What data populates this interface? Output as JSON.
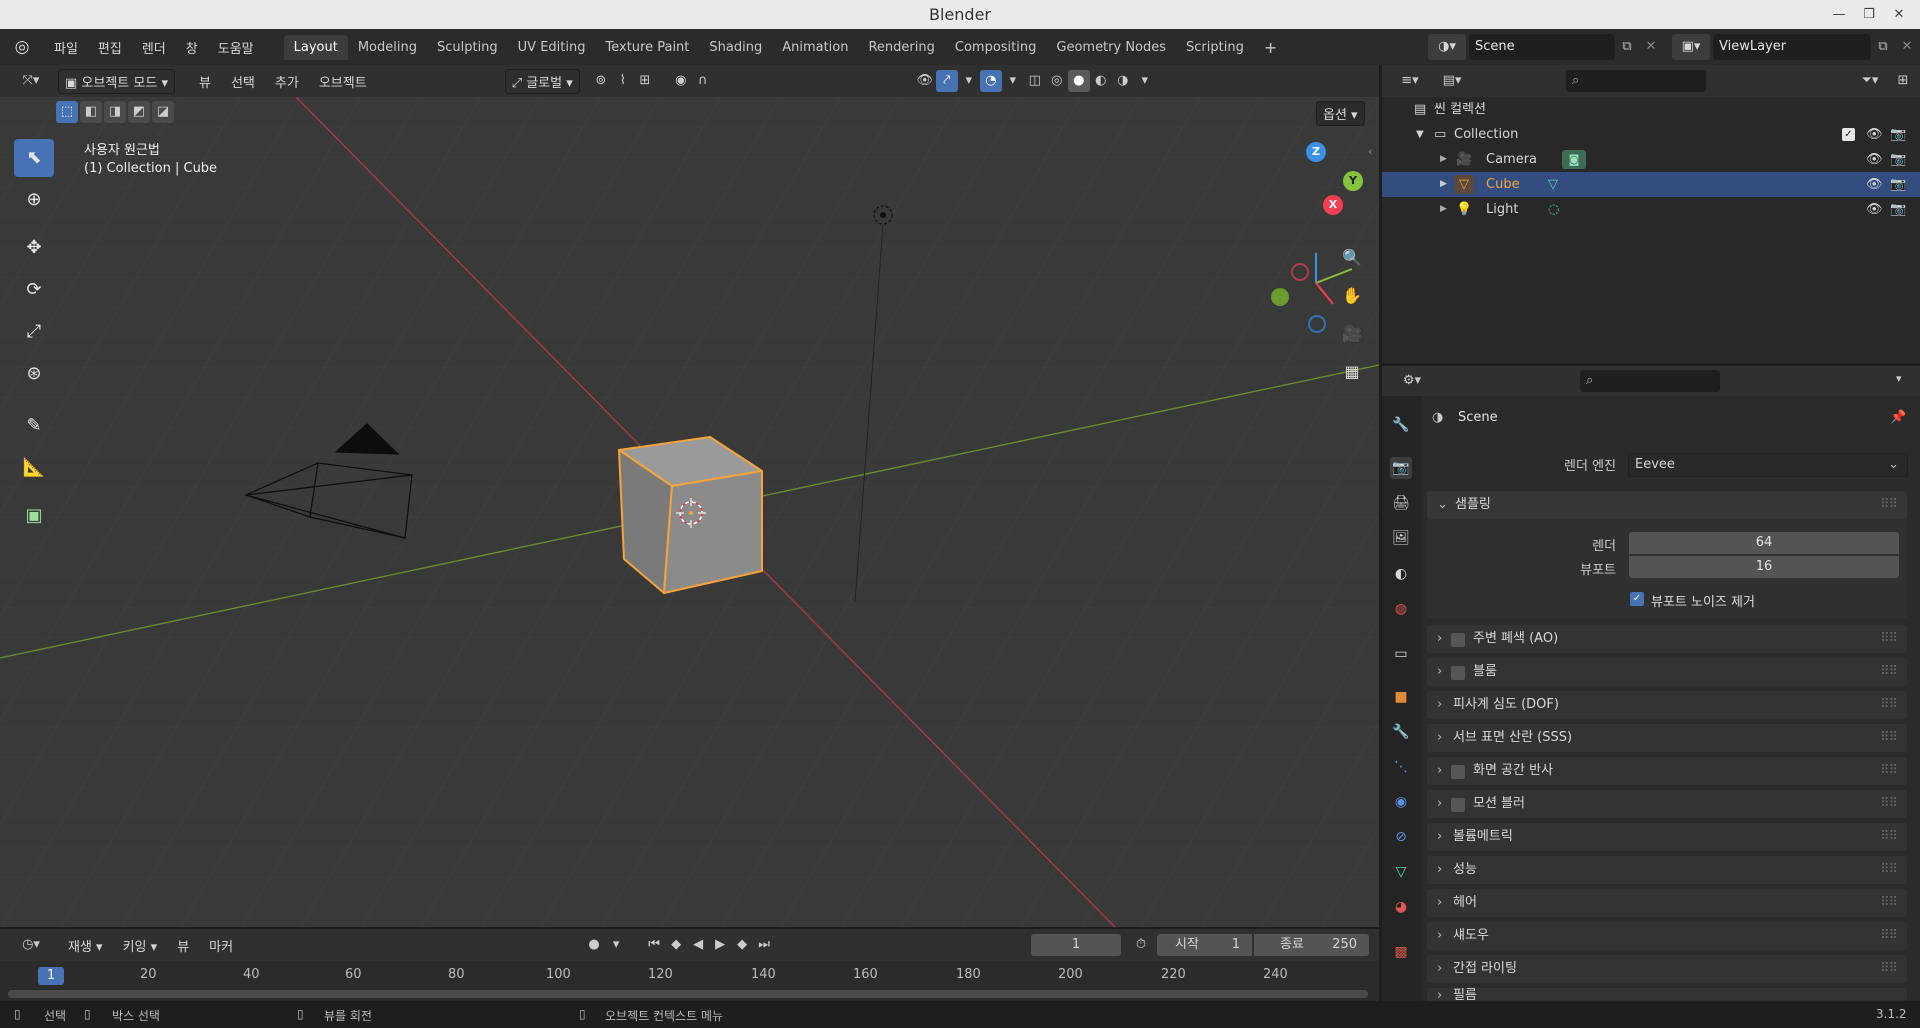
{
  "window": {
    "title": "Blender"
  },
  "menus": [
    "파일",
    "편집",
    "렌더",
    "창",
    "도움말"
  ],
  "workspaces": [
    "Layout",
    "Modeling",
    "Sculpting",
    "UV Editing",
    "Texture Paint",
    "Shading",
    "Animation",
    "Rendering",
    "Compositing",
    "Geometry Nodes",
    "Scripting"
  ],
  "add_workspace": "+",
  "scene_selector": {
    "scene": "Scene",
    "view_layer": "ViewLayer"
  },
  "viewport_header": {
    "mode": "오브젝트 모드",
    "menus": [
      "뷰",
      "선택",
      "추가",
      "오브젝트"
    ],
    "transform_orientation": "글로벌",
    "options": "옵션"
  },
  "viewport": {
    "view_name": "사용자 원근법",
    "object_info": "(1) Collection | Cube",
    "gizmo_labels": {
      "z": "Z",
      "y": "Y",
      "x": "X"
    }
  },
  "outliner": {
    "root": "씬 컬렉션",
    "collection": "Collection",
    "items": [
      {
        "name": "Camera",
        "selected": false
      },
      {
        "name": "Cube",
        "selected": true
      },
      {
        "name": "Light",
        "selected": false
      }
    ]
  },
  "properties": {
    "context": "Scene",
    "render_engine_label": "렌더 엔진",
    "render_engine_value": "Eevee",
    "sampling": {
      "title": "샘플링",
      "render_label": "렌더",
      "render_value": "64",
      "viewport_label": "뷰포트",
      "viewport_value": "16",
      "denoise_label": "뷰포트 노이즈 제거"
    },
    "panels": [
      "주변 폐색 (AO)",
      "블룸",
      "피사계 심도 (DOF)",
      "서브 표면 산란 (SSS)",
      "화면 공간 반사",
      "모션 블러",
      "볼륨메트릭",
      "성능",
      "헤어",
      "섀도우",
      "간접 라이팅",
      "필름"
    ]
  },
  "timeline": {
    "menus": [
      "재생",
      "키잉",
      "뷰",
      "마커"
    ],
    "current_frame": "1",
    "start_label": "시작",
    "start_value": "1",
    "end_label": "종료",
    "end_value": "250",
    "ruler": [
      "1",
      "20",
      "40",
      "60",
      "80",
      "100",
      "120",
      "140",
      "160",
      "180",
      "200",
      "220",
      "240"
    ]
  },
  "statusbar": {
    "select": "선택",
    "box_select": "박스 선택",
    "rotate_view": "뷰를 회전",
    "context_menu": "오브젝트 컨텍스트 메뉴",
    "version": "3.1.2"
  },
  "colors": {
    "accent": "#4772b3",
    "selection_orange": "#f5a33c",
    "x_axis": "#f53d53",
    "y_axis": "#86c23a",
    "z_axis": "#3b8fe6"
  }
}
